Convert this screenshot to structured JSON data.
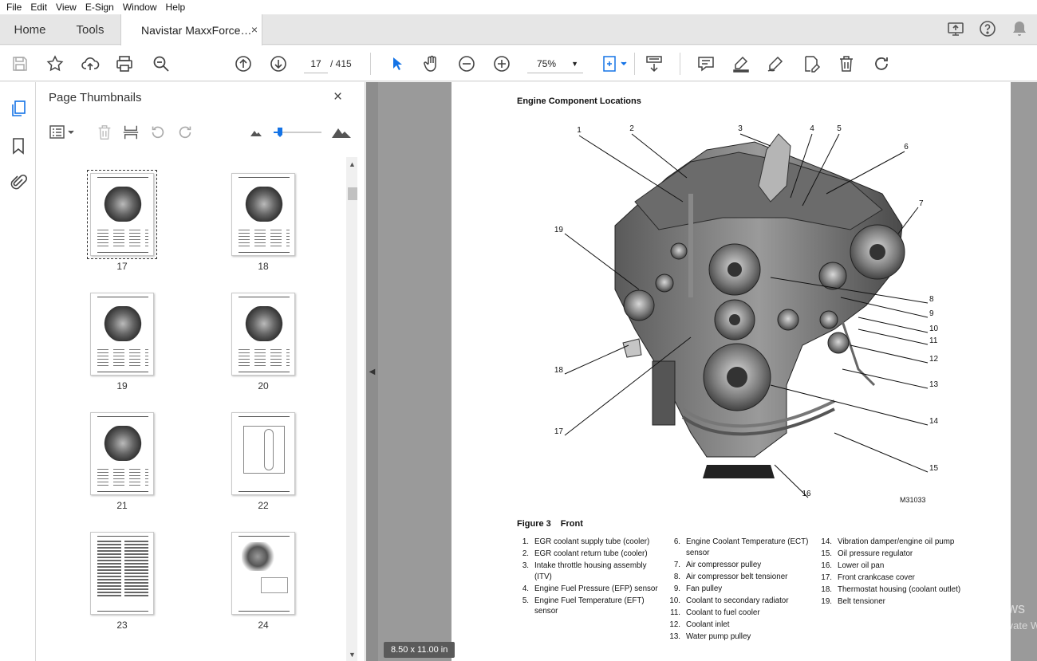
{
  "menu": [
    "File",
    "Edit",
    "View",
    "E-Sign",
    "Window",
    "Help"
  ],
  "tabs": {
    "home": "Home",
    "tools": "Tools",
    "document": "Navistar MaxxForce…",
    "close": "×"
  },
  "toolbar": {
    "current_page": "17",
    "total_pages": "/ 415",
    "zoom": "75%"
  },
  "panel": {
    "title": "Page Thumbnails",
    "close": "×",
    "thumbnails": [
      {
        "label": "17",
        "kind": "engine",
        "selected": true
      },
      {
        "label": "18",
        "kind": "engine",
        "selected": false
      },
      {
        "label": "19",
        "kind": "engine",
        "selected": false
      },
      {
        "label": "20",
        "kind": "engine",
        "selected": false
      },
      {
        "label": "21",
        "kind": "engine",
        "selected": false
      },
      {
        "label": "22",
        "kind": "diagram",
        "selected": false
      },
      {
        "label": "23",
        "kind": "text",
        "selected": false
      },
      {
        "label": "24",
        "kind": "parts",
        "selected": false
      }
    ]
  },
  "document": {
    "heading": "Engine Component Locations",
    "figure_label": "Figure 3",
    "figure_title": "Front",
    "figure_id": "M31033",
    "page_size": "8.50 x 11.00 in",
    "legend": [
      [
        {
          "num": "1.",
          "text": "EGR coolant supply tube (cooler)"
        },
        {
          "num": "2.",
          "text": "EGR coolant return tube (cooler)"
        },
        {
          "num": "3.",
          "text": "Intake throttle housing assembly (ITV)"
        },
        {
          "num": "4.",
          "text": "Engine Fuel Pressure (EFP) sensor"
        },
        {
          "num": "5.",
          "text": "Engine Fuel Temperature (EFT) sensor"
        }
      ],
      [
        {
          "num": "6.",
          "text": "Engine Coolant Temperature (ECT) sensor"
        },
        {
          "num": "7.",
          "text": "Air compressor pulley"
        },
        {
          "num": "8.",
          "text": "Air compressor belt tensioner"
        },
        {
          "num": "9.",
          "text": "Fan pulley"
        },
        {
          "num": "10.",
          "text": "Coolant to secondary radiator"
        },
        {
          "num": "11.",
          "text": "Coolant to fuel cooler"
        },
        {
          "num": "12.",
          "text": "Coolant inlet"
        },
        {
          "num": "13.",
          "text": "Water pump pulley"
        }
      ],
      [
        {
          "num": "14.",
          "text": "Vibration damper/engine oil pump"
        },
        {
          "num": "15.",
          "text": "Oil pressure regulator"
        },
        {
          "num": "16.",
          "text": "Lower oil pan"
        },
        {
          "num": "17.",
          "text": "Front crankcase cover"
        },
        {
          "num": "18.",
          "text": "Thermostat housing (coolant outlet)"
        },
        {
          "num": "19.",
          "text": "Belt tensioner"
        }
      ]
    ],
    "callouts": [
      "1",
      "2",
      "3",
      "4",
      "5",
      "6",
      "7",
      "8",
      "9",
      "10",
      "11",
      "12",
      "13",
      "14",
      "15",
      "16",
      "17",
      "18",
      "19"
    ]
  },
  "watermark": {
    "line1": "Activate Windows",
    "line2": "Go to Settings to activate Windows."
  }
}
